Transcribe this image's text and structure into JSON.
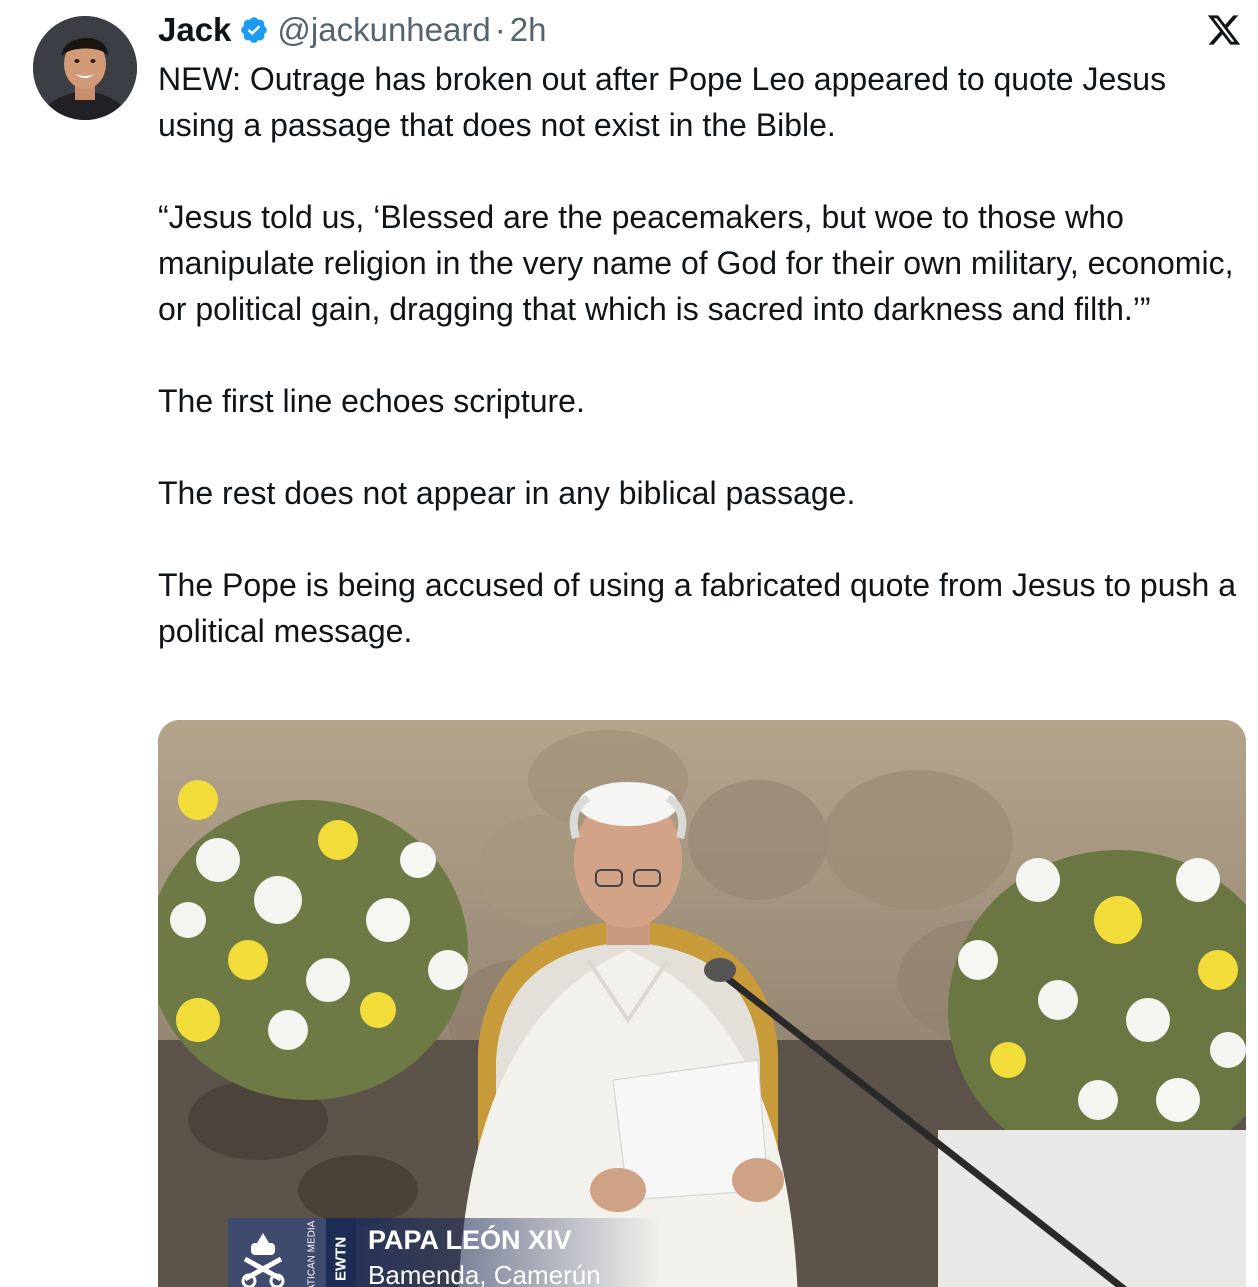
{
  "author": {
    "display_name": "Jack",
    "handle": "@jackunheard",
    "separator": "·",
    "time": "2h",
    "verified_icon": "verified-badge-icon",
    "avatar": "avatar"
  },
  "platform_icon": "x-logo-icon",
  "tweet": {
    "paragraphs": [
      "NEW: Outrage has broken out after Pope Leo appeared to quote Jesus using a passage that does not exist in the Bible.",
      "“Jesus told us, ‘Blessed are the peacemakers, but woe to those who manipulate religion in the very name of God for their own military, economic, or political gain, dragging that which is sacred into darkness and filth.’”",
      "The first line echoes scripture.",
      "The rest does not appear in any biblical passage.",
      "The Pope is being accused of using a fabricated quote from Jesus to push a political message."
    ]
  },
  "media": {
    "lower_third": {
      "title": "PAPA LEÓN XIV",
      "subtitle": "Bamenda, Camerún",
      "network": "EWTN",
      "source": "VATICAN MEDIA"
    }
  },
  "colors": {
    "text": "#0f1419",
    "secondary": "#536471",
    "verified": "#1d9bf0"
  }
}
